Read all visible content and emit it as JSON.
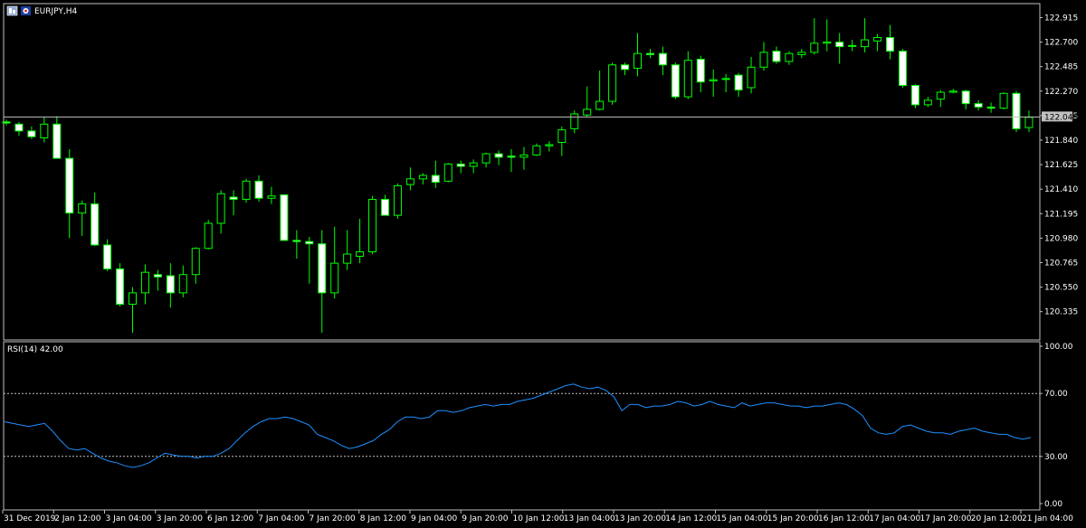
{
  "window": {
    "symbol_title": "EURJPY,H4",
    "icons": [
      "chart-window-icon",
      "symbol-flag-icon"
    ]
  },
  "colors": {
    "background": "#000000",
    "frame": "#c0c0c0",
    "bull_body": "#000000",
    "bull_outline": "#00ff00",
    "bear_body": "#ffffff",
    "wick": "#00ff00",
    "rsi_line": "#1e90ff",
    "level_line": "#c0c0c0",
    "price_line": "#c0c0c0",
    "text": "#ffffff"
  },
  "chart_data": [
    {
      "type": "candlestick",
      "symbol": "EURJPY",
      "timeframe": "H4",
      "ylim": [
        120.15,
        122.99
      ],
      "yticks": [
        "122.915",
        "122.700",
        "122.485",
        "122.270",
        "122.055",
        "121.840",
        "121.625",
        "121.410",
        "121.195",
        "120.980",
        "120.765",
        "120.550",
        "120.335"
      ],
      "current_price": "122.043",
      "xticks": [
        "31 Dec 2019",
        "2 Jan 12:00",
        "3 Jan 04:00",
        "3 Jan 20:00",
        "6 Jan 12:00",
        "7 Jan 04:00",
        "7 Jan 20:00",
        "8 Jan 12:00",
        "9 Jan 04:00",
        "9 Jan 20:00",
        "10 Jan 12:00",
        "13 Jan 04:00",
        "13 Jan 20:00",
        "14 Jan 12:00",
        "15 Jan 04:00",
        "15 Jan 20:00",
        "16 Jan 12:00",
        "17 Jan 04:00",
        "17 Jan 20:00",
        "20 Jan 12:00",
        "21 Jan 04:00"
      ],
      "ohlc": [
        [
          122.0,
          122.02,
          121.97,
          121.99
        ],
        [
          121.98,
          122.0,
          121.88,
          121.92
        ],
        [
          121.92,
          121.96,
          121.85,
          121.87
        ],
        [
          121.86,
          122.04,
          121.82,
          121.98
        ],
        [
          121.98,
          122.05,
          121.7,
          121.68
        ],
        [
          121.68,
          121.76,
          120.98,
          121.2
        ],
        [
          121.2,
          121.31,
          121.0,
          121.28
        ],
        [
          121.28,
          121.38,
          120.91,
          120.92
        ],
        [
          120.92,
          120.97,
          120.69,
          120.71
        ],
        [
          120.71,
          120.76,
          120.38,
          120.4
        ],
        [
          120.4,
          120.55,
          120.15,
          120.5
        ],
        [
          120.5,
          120.75,
          120.4,
          120.68
        ],
        [
          120.66,
          120.7,
          120.52,
          120.64
        ],
        [
          120.65,
          120.76,
          120.37,
          120.5
        ],
        [
          120.5,
          120.74,
          120.46,
          120.66
        ],
        [
          120.66,
          120.9,
          120.58,
          120.89
        ],
        [
          120.89,
          121.14,
          120.88,
          121.11
        ],
        [
          121.11,
          121.4,
          121.02,
          121.37
        ],
        [
          121.34,
          121.4,
          121.18,
          121.32
        ],
        [
          121.32,
          121.5,
          121.29,
          121.48
        ],
        [
          121.48,
          121.53,
          121.3,
          121.33
        ],
        [
          121.33,
          121.43,
          121.28,
          121.35
        ],
        [
          121.36,
          121.36,
          120.98,
          120.96
        ],
        [
          120.96,
          121.05,
          120.8,
          120.95
        ],
        [
          120.95,
          120.99,
          120.58,
          120.93
        ],
        [
          120.93,
          121.05,
          120.15,
          120.5
        ],
        [
          120.5,
          121.08,
          120.45,
          120.76
        ],
        [
          120.76,
          121.05,
          120.7,
          120.84
        ],
        [
          120.82,
          121.15,
          120.76,
          120.86
        ],
        [
          120.86,
          121.35,
          120.84,
          121.32
        ],
        [
          121.32,
          121.36,
          121.18,
          121.18
        ],
        [
          121.18,
          121.46,
          121.15,
          121.44
        ],
        [
          121.45,
          121.6,
          121.4,
          121.5
        ],
        [
          121.5,
          121.55,
          121.45,
          121.53
        ],
        [
          121.53,
          121.66,
          121.42,
          121.47
        ],
        [
          121.48,
          121.64,
          121.47,
          121.63
        ],
        [
          121.63,
          121.66,
          121.55,
          121.61
        ],
        [
          121.61,
          121.67,
          121.55,
          121.64
        ],
        [
          121.64,
          121.73,
          121.6,
          121.72
        ],
        [
          121.72,
          121.75,
          121.62,
          121.69
        ],
        [
          121.7,
          121.76,
          121.56,
          121.69
        ],
        [
          121.69,
          121.78,
          121.58,
          121.71
        ],
        [
          121.71,
          121.81,
          121.7,
          121.79
        ],
        [
          121.79,
          121.83,
          121.74,
          121.8
        ],
        [
          121.82,
          121.96,
          121.7,
          121.93
        ],
        [
          121.94,
          122.1,
          121.9,
          122.07
        ],
        [
          122.06,
          122.31,
          122.04,
          122.11
        ],
        [
          122.11,
          122.45,
          122.1,
          122.18
        ],
        [
          122.18,
          122.52,
          122.15,
          122.5
        ],
        [
          122.5,
          122.52,
          122.41,
          122.46
        ],
        [
          122.47,
          122.78,
          122.4,
          122.6
        ],
        [
          122.6,
          122.64,
          122.56,
          122.59
        ],
        [
          122.6,
          122.66,
          122.41,
          122.5
        ],
        [
          122.5,
          122.52,
          122.2,
          122.22
        ],
        [
          122.22,
          122.62,
          122.2,
          122.54
        ],
        [
          122.55,
          122.58,
          122.26,
          122.35
        ],
        [
          122.36,
          122.46,
          122.22,
          122.37
        ],
        [
          122.38,
          122.42,
          122.26,
          122.38
        ],
        [
          122.41,
          122.43,
          122.22,
          122.28
        ],
        [
          122.3,
          122.57,
          122.25,
          122.48
        ],
        [
          122.48,
          122.7,
          122.45,
          122.61
        ],
        [
          122.62,
          122.66,
          122.51,
          122.53
        ],
        [
          122.53,
          122.62,
          122.5,
          122.6
        ],
        [
          122.59,
          122.64,
          122.56,
          122.61
        ],
        [
          122.61,
          122.91,
          122.59,
          122.69
        ],
        [
          122.69,
          122.9,
          122.62,
          122.7
        ],
        [
          122.7,
          122.78,
          122.51,
          122.66
        ],
        [
          122.67,
          122.72,
          122.62,
          122.67
        ],
        [
          122.66,
          122.91,
          122.61,
          122.72
        ],
        [
          122.71,
          122.77,
          122.62,
          122.74
        ],
        [
          122.74,
          122.85,
          122.55,
          122.62
        ],
        [
          122.62,
          122.64,
          122.3,
          122.32
        ],
        [
          122.32,
          122.33,
          122.12,
          122.15
        ],
        [
          122.15,
          122.22,
          122.13,
          122.19
        ],
        [
          122.2,
          122.28,
          122.13,
          122.26
        ],
        [
          122.26,
          122.29,
          122.25,
          122.27
        ],
        [
          122.27,
          122.28,
          122.11,
          122.16
        ],
        [
          122.16,
          122.19,
          122.1,
          122.13
        ],
        [
          122.13,
          122.17,
          122.08,
          122.12
        ],
        [
          122.12,
          122.26,
          122.11,
          122.25
        ],
        [
          122.25,
          122.27,
          121.91,
          121.94
        ],
        [
          121.95,
          122.1,
          121.91,
          122.04
        ]
      ]
    },
    {
      "type": "line",
      "title": "RSI(14) 42.00",
      "ylim": [
        0,
        100
      ],
      "yticks": [
        "100.00",
        "70.00",
        "30.00",
        "0.00"
      ],
      "levels": [
        70,
        30
      ],
      "values": [
        52,
        51,
        50,
        49,
        50,
        51,
        46,
        40,
        35,
        34,
        35,
        32,
        29,
        27,
        26,
        24,
        23,
        24,
        26,
        29,
        32,
        31,
        30,
        30,
        29,
        30,
        30,
        32,
        35,
        40,
        45,
        49,
        52,
        54,
        54,
        55,
        54,
        52,
        50,
        44,
        42,
        40,
        37,
        35,
        36,
        38,
        40,
        44,
        47,
        52,
        55,
        55,
        54,
        55,
        59,
        59,
        58,
        59,
        61,
        62,
        63,
        62,
        63,
        63,
        65,
        66,
        67,
        69,
        71,
        73,
        75,
        76,
        74,
        73,
        74,
        72,
        68,
        59,
        63,
        63,
        61,
        62,
        62,
        63,
        65,
        64,
        62,
        63,
        65,
        63,
        62,
        61,
        64,
        62,
        63,
        64,
        64,
        63,
        62,
        62,
        61,
        62,
        62,
        63,
        64,
        63,
        60,
        56,
        48,
        45,
        44,
        45,
        49,
        50,
        48,
        46,
        45,
        45,
        44,
        46,
        47,
        48,
        46,
        45,
        44,
        44,
        42,
        41,
        42
      ]
    }
  ]
}
